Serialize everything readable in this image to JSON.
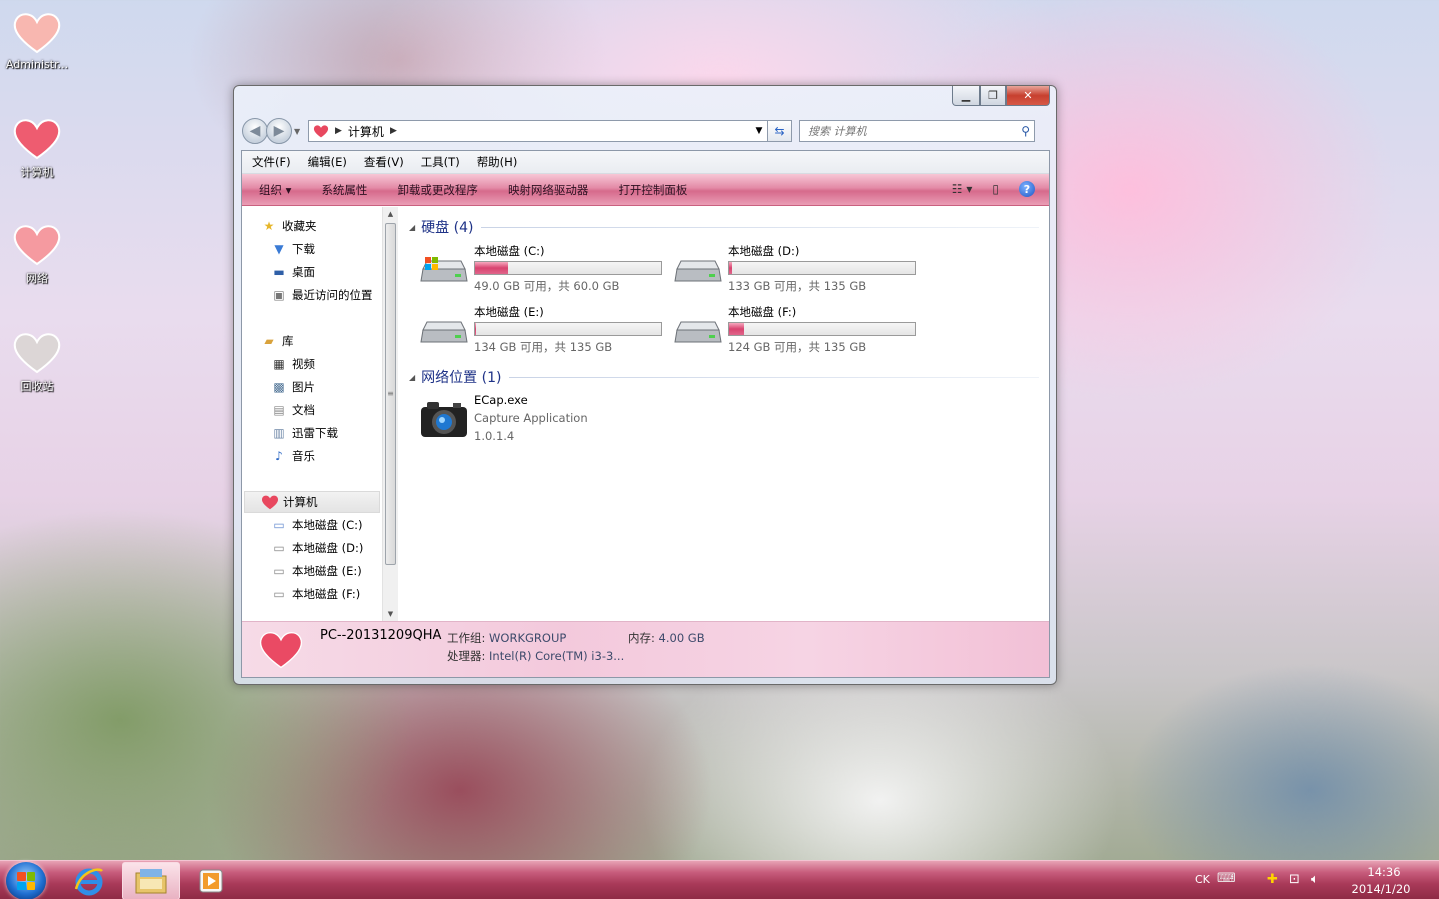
{
  "desktop": {
    "icons": [
      {
        "label": "Administr..."
      },
      {
        "label": "计算机"
      },
      {
        "label": "网络"
      },
      {
        "label": "回收站"
      }
    ]
  },
  "window": {
    "address": {
      "crumb": "计算机"
    },
    "search": {
      "placeholder": "搜索 计算机"
    },
    "menu": [
      "文件(F)",
      "编辑(E)",
      "查看(V)",
      "工具(T)",
      "帮助(H)"
    ],
    "commands": [
      "组织 ▾",
      "系统属性",
      "卸载或更改程序",
      "映射网络驱动器",
      "打开控制面板"
    ],
    "nav": {
      "favorites": "收藏夹",
      "fav_items": [
        "下载",
        "桌面",
        "最近访问的位置"
      ],
      "libraries": "库",
      "lib_items": [
        "视频",
        "图片",
        "文档",
        "迅雷下载",
        "音乐"
      ],
      "computer": "计算机",
      "computer_items": [
        "本地磁盘 (C:)",
        "本地磁盘 (D:)",
        "本地磁盘 (E:)",
        "本地磁盘 (F:)"
      ]
    },
    "groups": {
      "disks": "硬盘 (4)",
      "network": "网络位置 (1)"
    },
    "drives": [
      {
        "name": "本地磁盘 (C:)",
        "free": "49.0 GB 可用，共 60.0 GB",
        "used_fraction": 0.18
      },
      {
        "name": "本地磁盘 (D:)",
        "free": "133 GB 可用，共 135 GB",
        "used_fraction": 0.015
      },
      {
        "name": "本地磁盘 (E:)",
        "free": "134 GB 可用，共 135 GB",
        "used_fraction": 0.007
      },
      {
        "name": "本地磁盘 (F:)",
        "free": "124 GB 可用，共 135 GB",
        "used_fraction": 0.08
      }
    ],
    "network_item": {
      "name": "ECap.exe",
      "description": "Capture Application",
      "version": "1.0.1.4"
    },
    "details": {
      "pc_name": "PC--20131209QHA",
      "workgroup_label": "工作组:",
      "workgroup": "WORKGROUP",
      "memory_label": "内存:",
      "memory": "4.00 GB",
      "cpu_label": "处理器:",
      "cpu": "Intel(R) Core(TM) i3-3..."
    }
  },
  "taskbar": {
    "input_indicator": "CK",
    "time": "14:36",
    "date": "2014/1/20"
  },
  "colors": {
    "accent_pink": "#d66a8c",
    "group_header": "#1e3287",
    "taskbar": "#a93a59"
  }
}
